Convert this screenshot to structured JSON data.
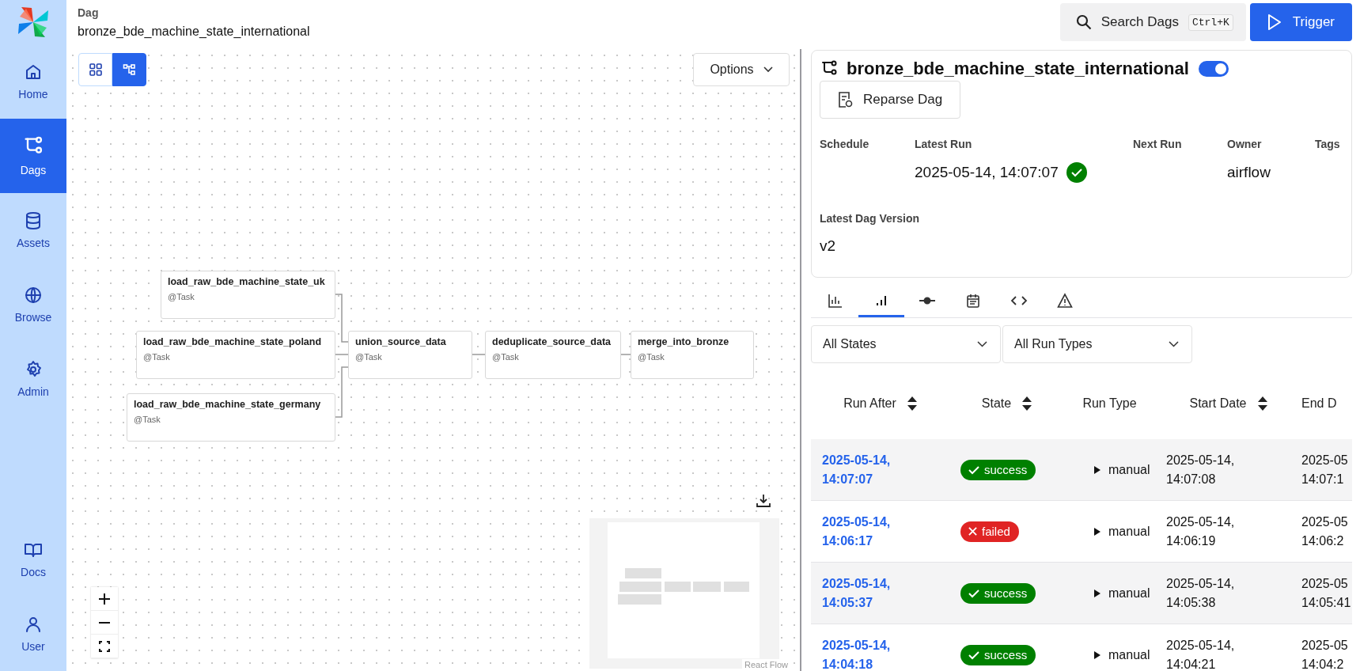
{
  "sidebar": {
    "items": [
      {
        "label": "Home",
        "selected": false
      },
      {
        "label": "Dags",
        "selected": true
      },
      {
        "label": "Assets",
        "selected": false
      },
      {
        "label": "Browse",
        "selected": false
      },
      {
        "label": "Admin",
        "selected": false
      },
      {
        "label": "Docs",
        "selected": false
      },
      {
        "label": "User",
        "selected": false
      }
    ]
  },
  "header": {
    "label": "Dag",
    "title": "bronze_bde_machine_state_international"
  },
  "search": {
    "label": "Search Dags",
    "shortcut": "Ctrl+K"
  },
  "trigger_button": "Trigger",
  "view_toggle": [
    {
      "selected": false
    },
    {
      "selected": true
    }
  ],
  "options_button": "Options",
  "graph": {
    "nodes": [
      {
        "name": "load_raw_bde_machine_state_uk",
        "type": "@Task"
      },
      {
        "name": "load_raw_bde_machine_state_poland",
        "type": "@Task"
      },
      {
        "name": "load_raw_bde_machine_state_germany",
        "type": "@Task"
      },
      {
        "name": "union_source_data",
        "type": "@Task"
      },
      {
        "name": "deduplicate_source_data",
        "type": "@Task"
      },
      {
        "name": "merge_into_bronze",
        "type": "@Task"
      }
    ],
    "attribution": "React Flow"
  },
  "dag_card": {
    "title": "bronze_bde_machine_state_international",
    "enabled": true,
    "reparse_button": "Reparse Dag",
    "fields": [
      {
        "label": "Schedule"
      },
      {
        "label": "Latest Run",
        "value": "2025-05-14, 14:07:07",
        "succeeded": true
      },
      {
        "label": "Next Run"
      },
      {
        "label": "Owner",
        "value": "airflow"
      },
      {
        "label": "Tags"
      }
    ],
    "version_label": "Latest Dag Version",
    "version": "v2"
  },
  "detail_tabs": [
    {
      "selected": false
    },
    {
      "selected": true
    },
    {
      "selected": false
    },
    {
      "selected": false
    },
    {
      "selected": false
    },
    {
      "selected": false
    }
  ],
  "filters": [
    {
      "value": "All States"
    },
    {
      "value": "All Run Types"
    }
  ],
  "runs_table": {
    "columns": [
      {
        "label": "Run After",
        "sortable": true
      },
      {
        "label": "State",
        "sortable": true
      },
      {
        "label": "Run Type",
        "sortable": false
      },
      {
        "label": "Start Date",
        "sortable": true
      },
      {
        "label": "End D",
        "sortable": false
      }
    ],
    "rows": [
      {
        "run_after": "2025-05-14, 14:07:07",
        "state": "success",
        "run_type": "manual",
        "start_date": "2025-05-14, 14:07:08",
        "end_date": "2025-05 14:07:1"
      },
      {
        "run_after": "2025-05-14, 14:06:17",
        "state": "failed",
        "run_type": "manual",
        "start_date": "2025-05-14, 14:06:19",
        "end_date": "2025-05 14:06:2"
      },
      {
        "run_after": "2025-05-14, 14:05:37",
        "state": "success",
        "run_type": "manual",
        "start_date": "2025-05-14, 14:05:38",
        "end_date": "2025-05 14:05:41"
      },
      {
        "run_after": "2025-05-14, 14:04:18",
        "state": "success",
        "run_type": "manual",
        "start_date": "2025-05-14, 14:04:21",
        "end_date": "2025-05 14:04:2"
      }
    ]
  }
}
